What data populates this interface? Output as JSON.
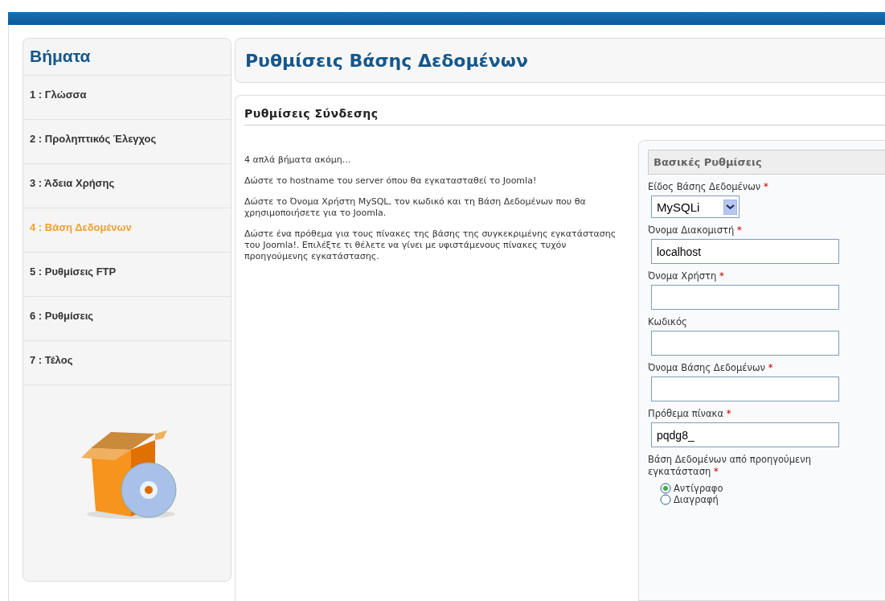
{
  "sidebar": {
    "title": "Βήματα",
    "steps": [
      {
        "label": "1 : Γλώσσα",
        "selected": false
      },
      {
        "label": "2 : Προληπτικός Έλεγχος",
        "selected": false
      },
      {
        "label": "3 : Άδεια Χρήσης",
        "selected": false
      },
      {
        "label": "4 : Βάση Δεδομένων",
        "selected": true
      },
      {
        "label": "5 : Ρυθμίσεις FTP",
        "selected": false
      },
      {
        "label": "6 : Ρυθμίσεις",
        "selected": false
      },
      {
        "label": "7 : Τέλος",
        "selected": false
      }
    ]
  },
  "page_title": "Ρυθμίσεις Βάσης Δεδομένων",
  "section": {
    "title": "Ρυθμίσεις Σύνδεσης",
    "paragraphs": [
      "4 απλά βήματα ακόμη...",
      "Δώστε το hostname του server όπου θα εγκατασταθεί το Joomla!",
      "Δώστε το Όνομα Χρήστη MySQL, τον κωδικό και τη Βάση Δεδομένων που θα χρησιμοποιήσετε για το Joomla.",
      "Δώστε ένα πρόθεμα για τους πίνακες της βάσης της συγκεκριμένης εγκατάστασης του Joomla!. Επιλέξτε τι θέλετε να γίνει με υφιστάμενους πίνακες τυχόν προηγούμενης εγκατάστασης."
    ],
    "form": {
      "title": "Βασικές Ρυθμίσεις",
      "fields": [
        {
          "kind": "select",
          "label": "Είδος Βάσης Δεδομένων",
          "required_mark": "*",
          "value": "MySQLi"
        },
        {
          "kind": "text",
          "label": "Όνομα Διακομιστή",
          "required_mark": "*",
          "value": "localhost"
        },
        {
          "kind": "text",
          "label": "Όνομα Χρήστη",
          "required_mark": "*"
        },
        {
          "kind": "text",
          "label": "Κωδικός"
        },
        {
          "kind": "text",
          "label": "Όνομα Βάσης Δεδομένων",
          "required_mark": "*"
        },
        {
          "kind": "text",
          "label": "Πρόθεμα πίνακα",
          "required_mark": "*",
          "value": "pqdg8_"
        },
        {
          "kind": "radio",
          "label": "Βάση Δεδομένων από προηγούμενη εγκατάσταση",
          "required_mark": "*",
          "options": [
            {
              "label": "Αντίγραφο",
              "selected": true
            },
            {
              "label": "Διαγραφή",
              "selected": false
            }
          ]
        }
      ]
    }
  }
}
